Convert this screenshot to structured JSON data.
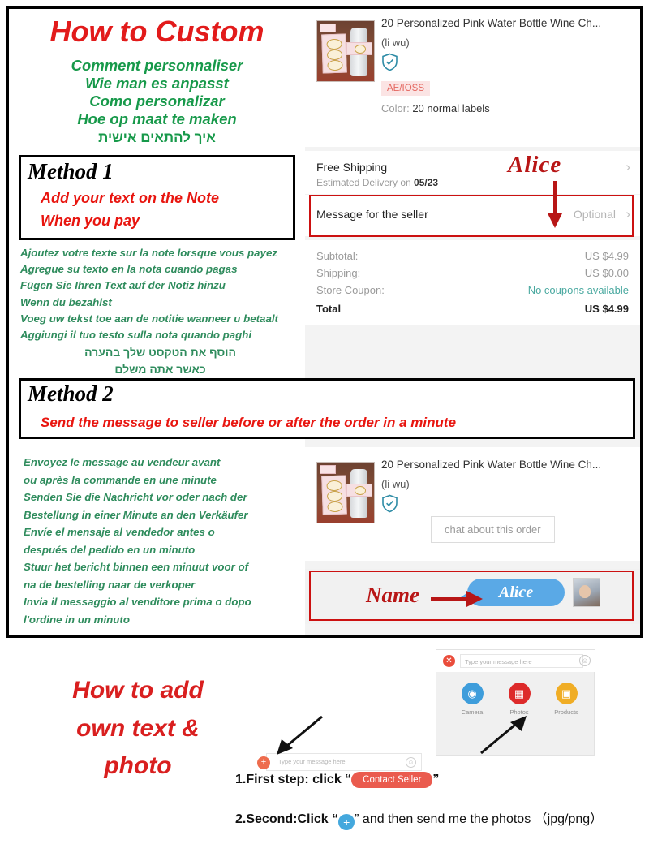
{
  "header": {
    "title": "How  to Custom",
    "subtitles": [
      "Comment personnaliser",
      "Wie man es anpasst",
      "Como personalizar",
      "Hoe op maat te maken",
      "איך להתאים אישית"
    ]
  },
  "method1": {
    "label": "Method 1",
    "line1": "Add your text on the Note",
    "line2": "When you pay",
    "translations": [
      "Ajoutez votre texte sur la note lorsque vous payez",
      "Agregue su texto en la nota cuando pagas",
      "Fügen Sie Ihren Text auf der Notiz hinzu",
      "Wenn du bezahlst",
      "Voeg uw tekst toe aan de notitie wanneer u betaalt",
      "Aggiungi il tuo testo sulla nota quando paghi"
    ],
    "translations_he": [
      "הוסף את הטקסט שלך בהערה",
      "כאשר אתה משלם"
    ]
  },
  "method2": {
    "label": "Method 2",
    "line1": "Send the message to seller before or after the order in a minute",
    "translations": [
      "Envoyez le message au vendeur avant",
      "ou après la commande en une minute",
      "Senden Sie die Nachricht vor oder nach der",
      "Bestellung in einer Minute an den Verkäufer",
      "Envíe el mensaje al vendedor antes o",
      "después del pedido en un minuto",
      "Stuur het bericht binnen een minuut voor of",
      "na de bestelling naar de verkoper",
      "Invia il messaggio al venditore prima o dopo",
      "l'ordine in un minuto"
    ]
  },
  "order": {
    "product_title": "20 Personalized Pink Water Bottle Wine Ch...",
    "seller": "(li wu)",
    "badge": "AE/IOSS",
    "color_label": "Color:",
    "color_value": "20 normal labels",
    "shipping_title": "Free Shipping",
    "shipping_sub_prefix": "Estimated Delivery on ",
    "shipping_date": "05/23",
    "message_label": "Message for the seller",
    "message_optional": "Optional",
    "summary": [
      {
        "label": "Subtotal:",
        "value": "US $4.99",
        "style": "muted"
      },
      {
        "label": "Shipping:",
        "value": "US $0.00",
        "style": "muted"
      },
      {
        "label": "Store Coupon:",
        "value": "No coupons available",
        "style": "teal"
      },
      {
        "label": "Total",
        "value": "US $4.99",
        "style": "total"
      }
    ]
  },
  "chat_order": {
    "product_title": "20 Personalized Pink Water Bottle Wine Ch...",
    "seller": "(li wu)",
    "chat_button": "chat about this order",
    "bubble_text": "Alice"
  },
  "annotations": {
    "alice": "Alice",
    "name": "Name"
  },
  "bottom": {
    "heading_line1": "How  to add",
    "heading_line2": "own text &",
    "heading_line3": "photo",
    "chat_widget": {
      "placeholder": "Type your message here",
      "apps": [
        {
          "label": "Camera",
          "color": "#3e9ddb",
          "glyph": "◎"
        },
        {
          "label": "Photos",
          "color": "#dd2a2a",
          "glyph": "▨"
        },
        {
          "label": "Products",
          "color": "#f0ad25",
          "glyph": "▣"
        }
      ]
    },
    "mini_chat": {
      "placeholder": "Type your message here"
    },
    "step1_prefix": "1.First step: click “",
    "step1_pill": "Contact Seller",
    "step1_suffix": "”",
    "step2_prefix": "2.Second:Click “",
    "step2_suffix": "” and then send me the photos （jpg/png）"
  },
  "colors": {
    "red": "#e21b1b",
    "green": "#17994a",
    "annotation_red": "#b81616",
    "bubble_blue": "#5aa9e6"
  }
}
